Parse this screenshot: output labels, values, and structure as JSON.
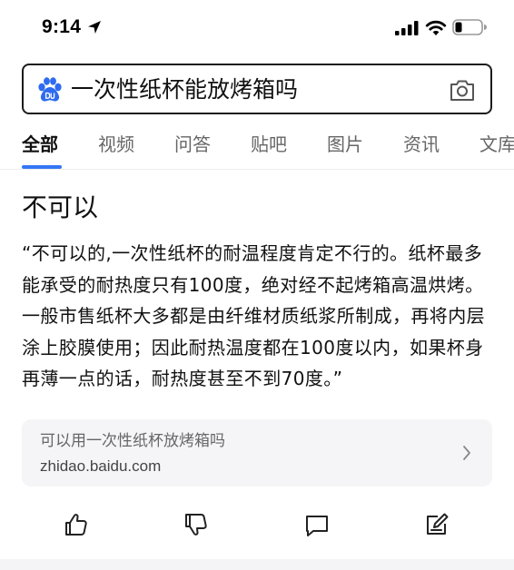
{
  "status_bar": {
    "time": "9:14"
  },
  "search": {
    "query": "一次性纸杯能放烤箱吗"
  },
  "tabs": [
    {
      "label": "全部",
      "active": true
    },
    {
      "label": "视频"
    },
    {
      "label": "问答"
    },
    {
      "label": "贴吧"
    },
    {
      "label": "图片"
    },
    {
      "label": "资讯"
    },
    {
      "label": "文库"
    }
  ],
  "answer": {
    "title": "不可以",
    "body": "“不可以的,一次性纸杯的耐温程度肯定不行的。纸杯最多能承受的耐热度只有100度，绝对经不起烤箱高温烘烤。一般市售纸杯大多都是由纤维材质纸浆所制成，再将内层涂上胶膜使用；因此耐热温度都在100度以内，如果杯身再薄一点的话，耐热度甚至不到70度。”"
  },
  "source": {
    "title": "可以用一次性纸杯放烤箱吗",
    "url": "zhidao.baidu.com"
  },
  "actions": [
    {
      "icon": "thumbs-up-icon"
    },
    {
      "icon": "thumbs-down-icon"
    },
    {
      "icon": "comment-icon"
    },
    {
      "icon": "edit-icon"
    }
  ],
  "colors": {
    "accent": "#3476f6",
    "baidu_blue": "#2f6bf0",
    "card_bg": "#f5f5f7"
  }
}
